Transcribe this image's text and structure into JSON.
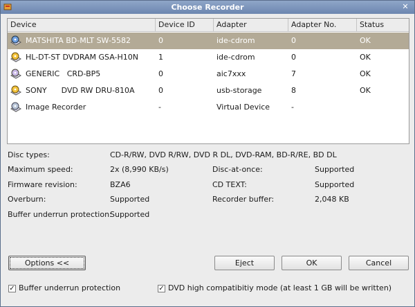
{
  "window": {
    "title": "Choose Recorder"
  },
  "table": {
    "columns": [
      "Device",
      "Device ID",
      "Adapter",
      "Adapter No.",
      "Status"
    ],
    "rows": [
      {
        "device": "MATSHITA BD-MLT SW-5582",
        "device_id": "0",
        "adapter": "ide-cdrom",
        "adapter_no": "0",
        "status": "OK",
        "icon": "bd-writer-icon",
        "selected": true
      },
      {
        "device": "HL-DT-ST DVDRAM GSA-H10N",
        "device_id": "1",
        "adapter": "ide-cdrom",
        "adapter_no": "0",
        "status": "OK",
        "icon": "dvd-writer-icon"
      },
      {
        "device": "GENERIC   CRD-BP5",
        "device_id": "0",
        "adapter": "aic7xxx",
        "adapter_no": "7",
        "status": "OK",
        "icon": "cd-writer-icon"
      },
      {
        "device": "SONY      DVD RW DRU-810A",
        "device_id": "0",
        "adapter": "usb-storage",
        "adapter_no": "8",
        "status": "OK",
        "icon": "dvd-writer-icon"
      },
      {
        "device": "Image Recorder",
        "device_id": "-",
        "adapter": "Virtual Device",
        "adapter_no": "-",
        "status": "",
        "icon": "image-recorder-icon"
      }
    ]
  },
  "details": {
    "disc_types_label": "Disc types:",
    "disc_types_value": "CD-R/RW, DVD R/RW, DVD R DL, DVD-RAM, BD-R/RE, BD DL",
    "max_speed_label": "Maximum speed:",
    "max_speed_value": "2x (8,990 KB/s)",
    "disc_at_once_label": "Disc-at-once:",
    "disc_at_once_value": "Supported",
    "firmware_label": "Firmware revision:",
    "firmware_value": "BZA6",
    "cd_text_label": "CD TEXT:",
    "cd_text_value": "Supported",
    "overburn_label": "Overburn:",
    "overburn_value": "Supported",
    "recorder_buffer_label": "Recorder buffer:",
    "recorder_buffer_value": "2,048 KB",
    "buffer_protection_label": "Buffer underrun protection:",
    "buffer_protection_value": "Supported"
  },
  "buttons": {
    "options": "Options <<",
    "eject": "Eject",
    "ok": "OK",
    "cancel": "Cancel"
  },
  "checkboxes": {
    "buffer_underrun": {
      "label": "Buffer underrun protection",
      "checked": true
    },
    "dvd_compat": {
      "label": "DVD high compatibitiy mode (at least 1 GB will be written)",
      "checked": true
    }
  }
}
